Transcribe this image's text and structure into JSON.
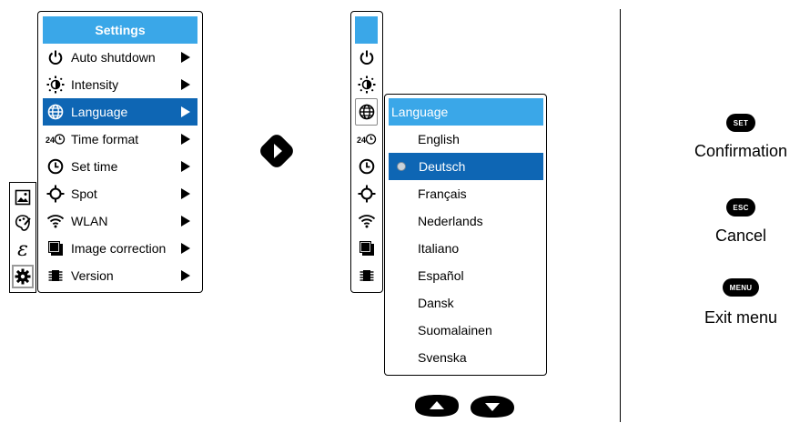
{
  "settings_menu": {
    "title": "Settings",
    "items": [
      {
        "label": "Auto shutdown",
        "icon": "power-icon",
        "selected": false
      },
      {
        "label": "Intensity",
        "icon": "brightness-icon",
        "selected": false
      },
      {
        "label": "Language",
        "icon": "globe-icon",
        "selected": true
      },
      {
        "label": "Time format",
        "icon": "24h-clock-icon",
        "selected": false
      },
      {
        "label": "Set time",
        "icon": "clock-icon",
        "selected": false
      },
      {
        "label": "Spot",
        "icon": "crosshair-icon",
        "selected": false
      },
      {
        "label": "WLAN",
        "icon": "wifi-icon",
        "selected": false
      },
      {
        "label": "Image correction",
        "icon": "image-stack-icon",
        "selected": false
      },
      {
        "label": "Version",
        "icon": "chip-icon",
        "selected": false
      }
    ]
  },
  "category_strip": {
    "items": [
      "image-icon",
      "palette-icon",
      "emissivity-icon",
      "gear-icon"
    ],
    "selected": "gear-icon"
  },
  "language_menu": {
    "title": "Language",
    "options": [
      "English",
      "Deutsch",
      "Français",
      "Nederlands",
      "Italiano",
      "Español",
      "Dansk",
      "Suomalainen",
      "Svenska"
    ],
    "selected": "Deutsch"
  },
  "legend": {
    "set": {
      "key": "SET",
      "caption": "Confirmation"
    },
    "esc": {
      "key": "ESC",
      "caption": "Cancel"
    },
    "menu": {
      "key": "MENU",
      "caption": "Exit menu"
    }
  },
  "colors": {
    "title_bg": "#3aa7e8",
    "selection_bg": "#0e66b4",
    "key_bg": "#000000"
  }
}
